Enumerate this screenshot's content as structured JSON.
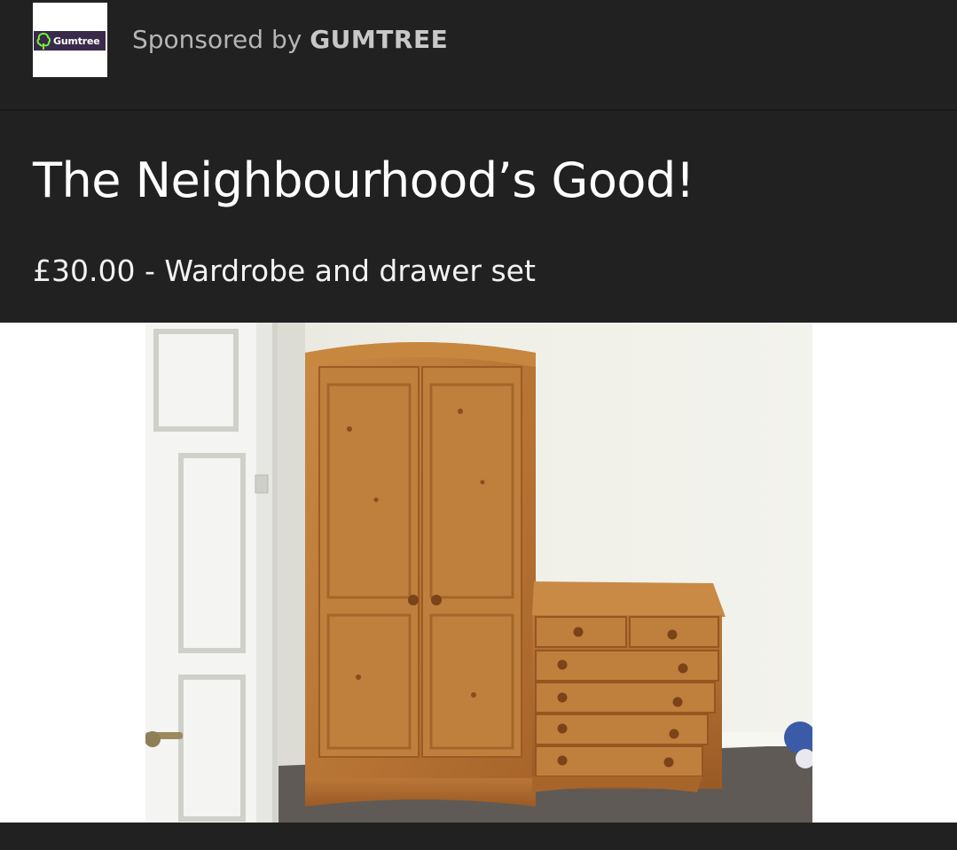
{
  "sponsor": {
    "logo_text": "Gumtree",
    "prefix": "Sponsored by",
    "name": "GUMTREE",
    "logo_icon": "tree-icon",
    "brand_color": "#72ef36"
  },
  "ad": {
    "headline": "The Neighbourhood’s Good!",
    "listing": "£30.00 - Wardrobe and drawer set"
  },
  "colors": {
    "background": "#212121",
    "text": "#ffffff",
    "muted_text": "#b5b5b5"
  }
}
